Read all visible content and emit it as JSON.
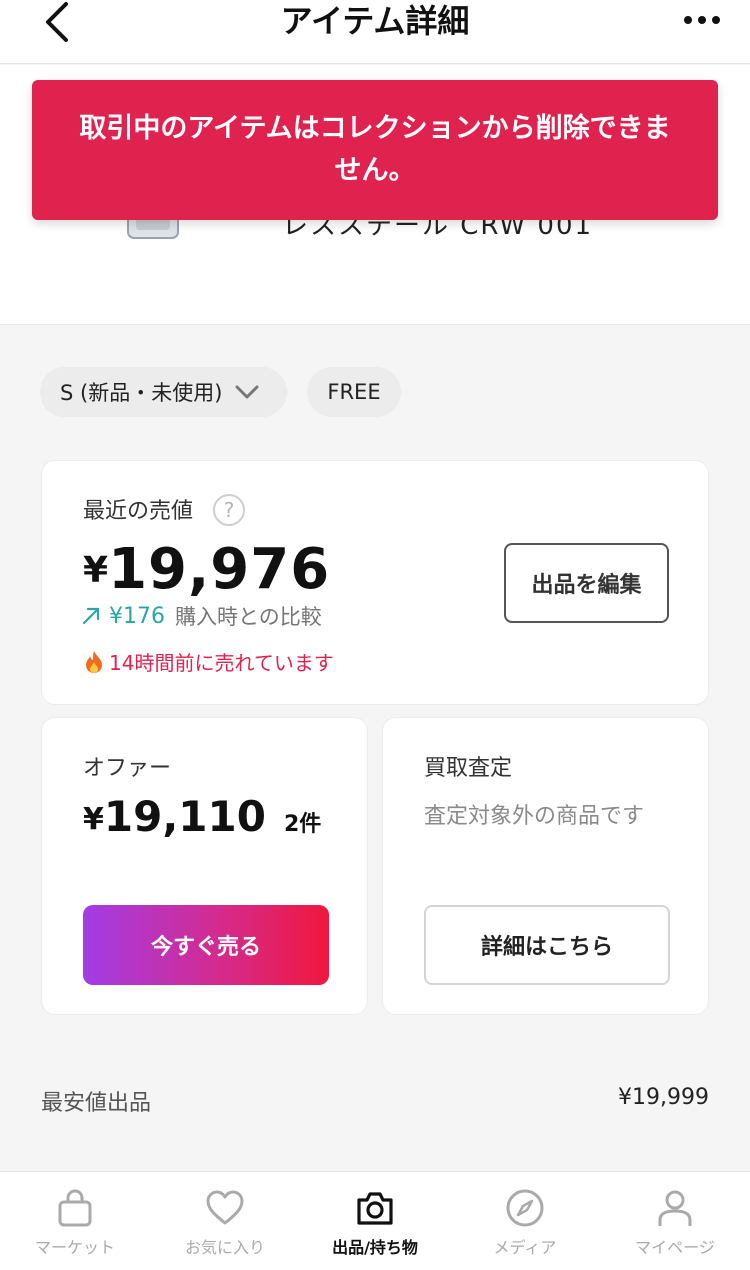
{
  "header": {
    "title": "アイテム詳細"
  },
  "product": {
    "name": "レスステール CRW 001"
  },
  "toast": {
    "message": "取引中のアイテムはコレクションから削除できません。"
  },
  "filters": {
    "size_selected": "S (新品・未使用)",
    "shipping": "FREE"
  },
  "price_card": {
    "label": "最近の売値",
    "help": "?",
    "currency": "¥",
    "price": "19,976",
    "diff_value": "¥176",
    "diff_label": "購入時との比較",
    "sold_note": "14時間前に売れています",
    "edit_button": "出品を編集"
  },
  "offer_card": {
    "label": "オファー",
    "currency": "¥",
    "price": "19,110",
    "count": "2件",
    "sell_button": "今すぐ売る"
  },
  "buyback_card": {
    "label": "買取査定",
    "note": "査定対象外の商品です",
    "detail_button": "詳細はこちら"
  },
  "lowest": {
    "label": "最安値出品",
    "price": "¥19,999"
  },
  "nav": {
    "items": [
      {
        "label": "マーケット",
        "icon": "bag-icon"
      },
      {
        "label": "お気に入り",
        "icon": "heart-icon"
      },
      {
        "label": "出品/持ち物",
        "icon": "camera-icon"
      },
      {
        "label": "メディア",
        "icon": "compass-icon"
      },
      {
        "label": "マイページ",
        "icon": "person-icon"
      }
    ],
    "active_index": 2
  },
  "colors": {
    "accent": "#e0224f",
    "teal": "#2ba6a6",
    "nav_inactive": "#aaaaaa"
  }
}
